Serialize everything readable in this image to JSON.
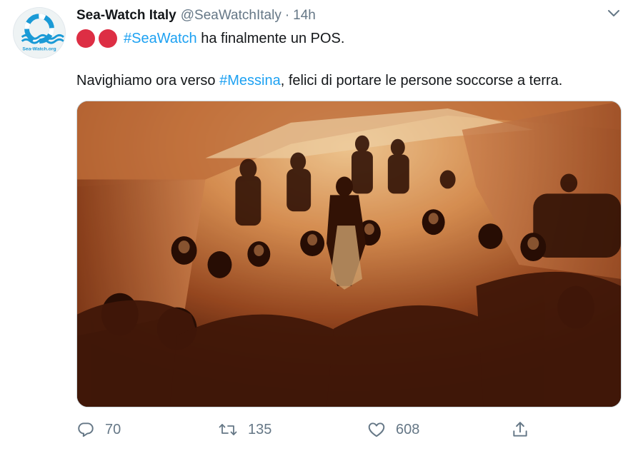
{
  "tweet": {
    "display_name": "Sea-Watch Italy",
    "handle": "@SeaWatchItaly",
    "separator": "·",
    "time": "14h",
    "avatar_text": "Sea-Watch.org",
    "line1": {
      "emoji": "red-circle-emoji",
      "hashtag": "#SeaWatch",
      "text": " ha finalmente un POS."
    },
    "line2": {
      "prefix": "Navighiamo ora verso ",
      "hashtag": "#Messina",
      "suffix": ", felici di portare le persone soccorse a terra."
    },
    "photo_icon": "photo-people-celebrating"
  },
  "actions": {
    "reply_count": "70",
    "retweet_count": "135",
    "like_count": "608"
  },
  "colors": {
    "link": "#1da1f2",
    "muted": "#657786",
    "emoji_red": "#dd2e44",
    "brand_blue": "#1a9ad6"
  },
  "icons": [
    "reply-icon",
    "retweet-icon",
    "like-icon",
    "share-icon",
    "chevron-down-icon"
  ]
}
